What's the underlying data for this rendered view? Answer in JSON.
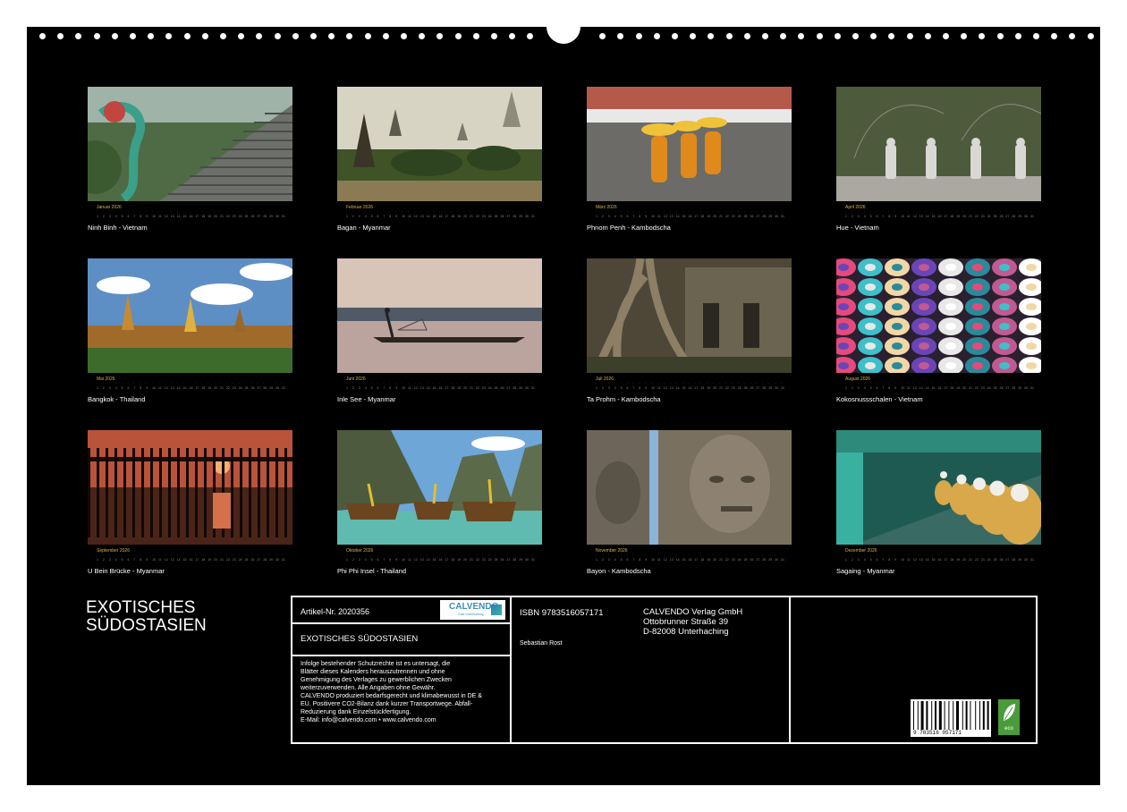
{
  "months": [
    {
      "name": "Januar 2026",
      "caption": "Ninh Binh - Vietnam",
      "theme": "dragon"
    },
    {
      "name": "Februar 2026",
      "caption": "Bagan - Myanmar",
      "theme": "bagan"
    },
    {
      "name": "März 2026",
      "caption": "Phnom Penh - Kambodscha",
      "theme": "monks"
    },
    {
      "name": "April 2026",
      "caption": "Hue - Vietnam",
      "theme": "hue"
    },
    {
      "name": "Mai 2026",
      "caption": "Bangkok - Thailand",
      "theme": "bangkok"
    },
    {
      "name": "Juni 2026",
      "caption": "Inle See - Myanmar",
      "theme": "inle"
    },
    {
      "name": "Juli 2026",
      "caption": "Ta Prohm - Kambodscha",
      "theme": "taprohm"
    },
    {
      "name": "August 2026",
      "caption": "Kokosnussschalen - Vietnam",
      "theme": "bowls"
    },
    {
      "name": "September 2026",
      "caption": "U Bein Brücke - Myanmar",
      "theme": "ubein"
    },
    {
      "name": "Oktober 2026",
      "caption": "Phi Phi Insel - Thailand",
      "theme": "phiphi"
    },
    {
      "name": "November 2026",
      "caption": "Bayon - Kambodscha",
      "theme": "bayon"
    },
    {
      "name": "Dezember 2026",
      "caption": "Sagaing - Myanmar",
      "theme": "sagaing"
    }
  ],
  "title": {
    "line1": "EXOTISCHES",
    "line2": "SÜDOSTASIEN"
  },
  "info": {
    "artikel": "Artikel-Nr. 2020356",
    "logo_text": "CALVENDO",
    "logo_sub": "Gute Unterhaltung",
    "product_title": "EXOTISCHES SÜDOSTASIEN",
    "legal": [
      "Infolge bestehender Schutzrechte ist es untersagt, die",
      "Blätter dieses Kalenders herauszutrennen und ohne",
      "Genehmigung des Verlages zu gewerblichen Zwecken",
      "weiterzuverwenden. Alle Angaben ohne Gewähr.",
      "CALVENDO produziert bedarfsgerecht und klimabewusst in DE &",
      "EU. Positivere CO2-Bilanz dank kurzer Transportwege. Abfall-",
      "Reduzierung dank Einzelstückfertigung.",
      "E-Mail: info@calvendo.com • www.calvendo.com"
    ],
    "isbn": "ISBN 9783516057171",
    "author": "Sebastian Rost",
    "publisher": [
      "CALVENDO Verlag GmbH",
      "Ottobrunner Straße 39",
      "D-82008 Unterhaching"
    ],
    "barcode_number": "9 783516 057171",
    "eco_label": "eco"
  }
}
